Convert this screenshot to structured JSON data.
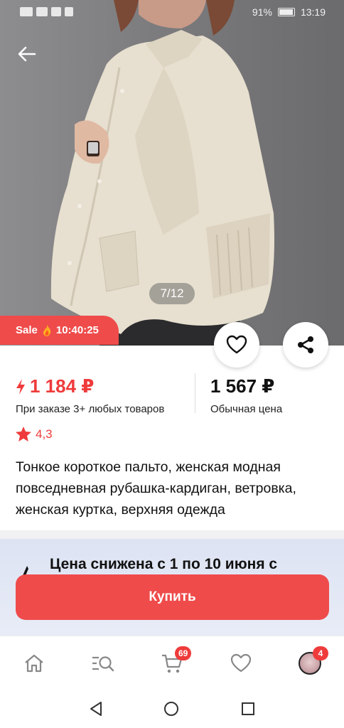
{
  "status_bar": {
    "battery": "91%",
    "time": "13:19"
  },
  "gallery": {
    "counter": "7/12"
  },
  "sale_badge": {
    "label": "Sale",
    "timer": "10:40:25"
  },
  "prices": {
    "promo_price": "1 184 ₽",
    "promo_note": "При заказе 3+ любых товаров",
    "regular_price": "1 567 ₽",
    "regular_note": "Обычная цена"
  },
  "rating": {
    "value": "4,3"
  },
  "product": {
    "title": "Тонкое короткое пальто, женская модная повседневная рубашка-кардиган, ветровка, женская куртка, верхняя одежда"
  },
  "promo_banner": {
    "text": "Цена снижена с 1 по 10 июня с"
  },
  "buy_button": {
    "label": "Купить"
  },
  "bottom_nav": {
    "items": [
      {
        "icon": "home-icon"
      },
      {
        "icon": "catalog-search-icon"
      },
      {
        "icon": "cart-icon",
        "badge": "69"
      },
      {
        "icon": "heart-icon"
      },
      {
        "icon": "profile-avatar",
        "badge": "4"
      }
    ]
  },
  "colors": {
    "accent": "#ef4b4b",
    "price_red": "#ef3b3b",
    "banner": "#dde3f3"
  }
}
